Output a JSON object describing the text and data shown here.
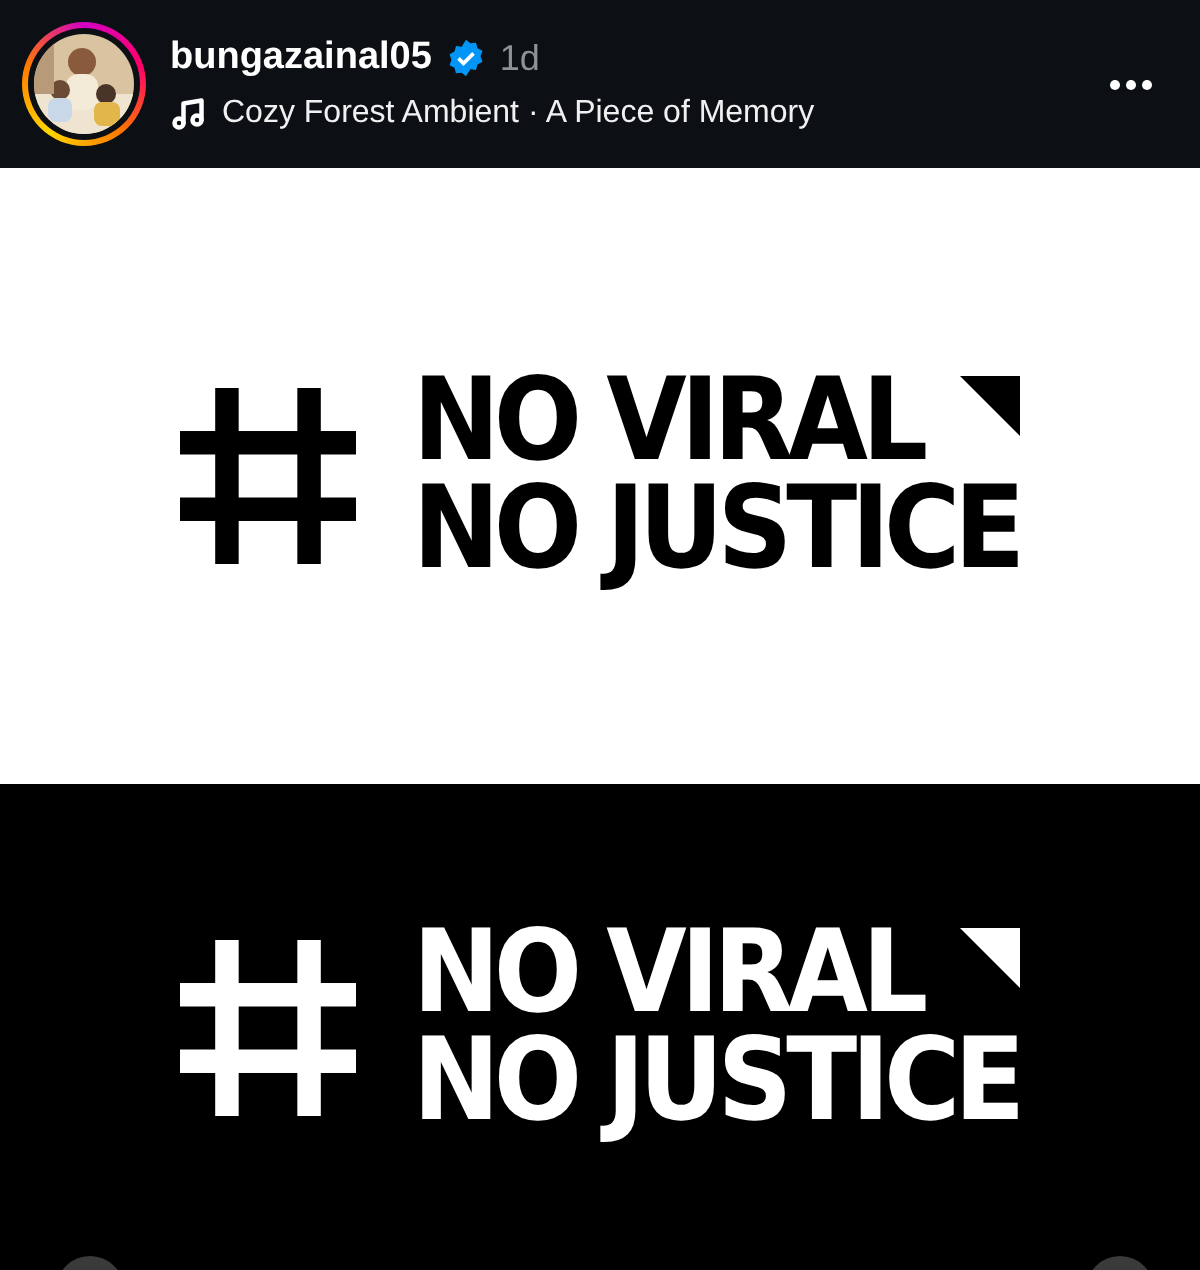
{
  "header": {
    "username": "bungazainal05",
    "verified": true,
    "time": "1d",
    "audio": "Cozy Forest Ambient · A Piece of Memory"
  },
  "post_panels": [
    {
      "inverted": false,
      "line_1": "NO VIRAL",
      "line_2": "NO JUSTICE"
    },
    {
      "inverted": true,
      "line_1": "NO VIRAL",
      "line_2": "NO JUSTICE"
    }
  ]
}
